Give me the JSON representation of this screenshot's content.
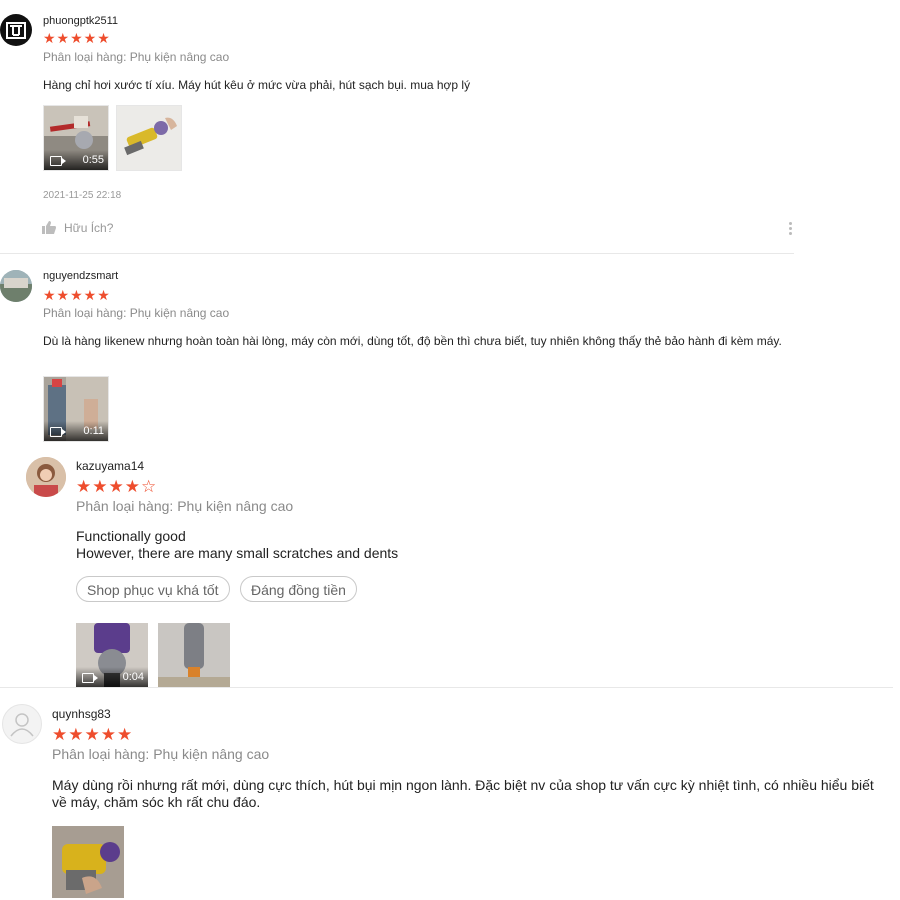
{
  "reviews": [
    {
      "username": "phuongptk2511",
      "stars": "★★★★★",
      "variant": "Phân loại hàng: Phụ kiện nâng cao",
      "content": "Hàng chỉ hơi xước tí xíu. Máy hút kêu ở mức vừa phải, hút sạch bụi. mua hợp lý",
      "video_duration": "0:55",
      "timestamp": "2021-11-25 22:18",
      "helpful_label": "Hữu Ích?"
    },
    {
      "username": "nguyendzsmart",
      "stars": "★★★★★",
      "variant": "Phân loại hàng: Phụ kiện nâng cao",
      "content": "Dù là hàng likenew nhưng hoàn toàn hài lòng, máy còn mới, dùng tốt, độ bền thì chưa biết, tuy nhiên không thấy thẻ bảo hành đi kèm máy.",
      "video_duration": "0:11"
    },
    {
      "username": "kazuyama14",
      "stars": "★★★★☆",
      "variant": "Phân loại hàng: Phụ kiện nâng cao",
      "content_line1": "Functionally good",
      "content_line2": "However, there are many small scratches and dents",
      "tags": [
        "Shop phục vụ khá tốt",
        "Đáng đồng tiền"
      ],
      "video_duration": "0:04"
    },
    {
      "username": "quynhsg83",
      "stars": "★★★★★",
      "variant": "Phân loại hàng: Phụ kiện nâng cao",
      "content": "Máy dùng rồi nhưng rất mới, dùng cực thích, hút bụi mịn ngon lành. Đặc biệt nv của shop tư vấn cực kỳ nhiệt tình, có nhiều hiểu biết về máy, chăm sóc kh rất chu đáo."
    }
  ],
  "colors": {
    "star": "#ee4d2d",
    "variant": "#8a8a8a",
    "divider": "#e8e8e8"
  }
}
